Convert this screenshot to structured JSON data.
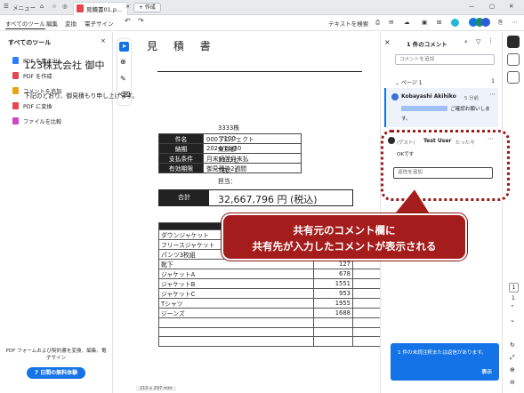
{
  "titlebar": {
    "menu_label": "メニュー",
    "doc_tab_label": "見積書01.p...",
    "new_tab_label": "+ 作成"
  },
  "toolbar": {
    "menus": [
      "すべてのツール",
      "編集",
      "変換",
      "電子サイン"
    ],
    "search_label": "テキストを検索"
  },
  "left_panel": {
    "title": "すべてのツール",
    "tools": [
      {
        "label": "PDF を書き出し",
        "color": "#2d7ff9"
      },
      {
        "label": "PDF を作成",
        "color": "#e34850"
      },
      {
        "label": "コメントを追加",
        "color": "#e8a418"
      },
      {
        "label": "PDF に変換",
        "color": "#e34850"
      },
      {
        "label": "ファイルを比較",
        "color": "#c948c9"
      }
    ],
    "promo_text": "PDF フォームおよび契約書を変換、編集、電子サイン",
    "trial_button": "7 日間の無料体験"
  },
  "document": {
    "title": "見 積 書",
    "client": "123株式会社 御中",
    "intro": "下記のとおり、御見積もり申し上げます。",
    "right_block": [
      "3333株",
      "〒100-",
      "東京都",
      "3333ビ",
      "TEL：(",
      "担当："
    ],
    "info": [
      {
        "label": "件名",
        "value": "000プロジェクト"
      },
      {
        "label": "納期",
        "value": "2024/11/30"
      },
      {
        "label": "支払条件",
        "value": "月末締翌月末払"
      },
      {
        "label": "有効期限",
        "value": "御見積後2週間"
      }
    ],
    "total_label": "合計",
    "total_value": "32,667,796 円 (税込)",
    "items": [
      {
        "name": "ダウンジャケット",
        "qty": ""
      },
      {
        "name": "フリースジャケット",
        "qty": ""
      },
      {
        "name": "パンツ3枚組",
        "qty": ""
      },
      {
        "name": "靴下",
        "qty": "127"
      },
      {
        "name": "ジャケットA",
        "qty": "678"
      },
      {
        "name": "ジャケットB",
        "qty": "1551"
      },
      {
        "name": "ジャケットC",
        "qty": "953"
      },
      {
        "name": "Tシャツ",
        "qty": "1955"
      },
      {
        "name": "ジーンズ",
        "qty": "1688"
      }
    ],
    "page_size": "210 x 297 mm"
  },
  "comments_panel": {
    "title": "1 件のコメント",
    "add_placeholder": "コメントを追加",
    "page_label": "ページ 1",
    "page_count": "1",
    "comment1": {
      "author": "Kobayashi Akihiko",
      "time": "5 分前",
      "text_line1": "ご確認お願いしま",
      "text_line2": "す。"
    },
    "comment2": {
      "guest_label": "(ゲスト)",
      "author": "Test User",
      "time": "たった今",
      "text": "OKです",
      "reply_placeholder": "返信を追加"
    },
    "notification": {
      "text": "1 件の未読注釈または返信があります。",
      "button": "表示"
    }
  },
  "right_rail": {
    "page_number": "1",
    "page_total": "1"
  },
  "callout": {
    "line1": "共有元のコメント欄に",
    "line2": "共有先が入力したコメントが表示される"
  },
  "colors": {
    "accent": "#1473e6",
    "callout_red": "#a41c1c",
    "comment_badge": "#8b5cf6"
  }
}
